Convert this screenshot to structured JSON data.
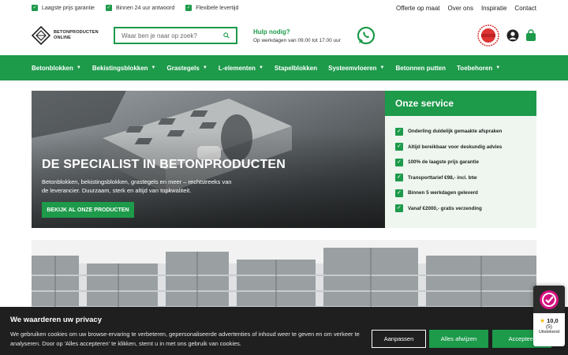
{
  "topbar": {
    "usps": [
      "Laagste prijs garantie",
      "Binnen 24 uur antwoord",
      "Flexibele levertijd"
    ],
    "links": [
      "Offerte op maat",
      "Over ons",
      "Inspiratie",
      "Contact"
    ]
  },
  "header": {
    "logo_line1": "BETONPRODUCTEN",
    "logo_line2": "ONLINE",
    "search_placeholder": "Waar ben je naar op zoek?",
    "help_title": "Hulp nodig?",
    "help_hours": "Op werkdagen van 09.00 tot 17.00 uur"
  },
  "nav": [
    {
      "label": "Betonblokken",
      "dropdown": true
    },
    {
      "label": "Bekistingsblokken",
      "dropdown": true
    },
    {
      "label": "Grastegels",
      "dropdown": true
    },
    {
      "label": "L-elementen",
      "dropdown": true
    },
    {
      "label": "Stapelblokken",
      "dropdown": false
    },
    {
      "label": "Systeemvloeren",
      "dropdown": true
    },
    {
      "label": "Betonnen putten",
      "dropdown": false
    },
    {
      "label": "Toebehoren",
      "dropdown": true
    }
  ],
  "hero": {
    "title": "DE SPECIALIST IN BETONPRODUCTEN",
    "text": "Betonblokken, bekistingsblokken, grastegels en meer – rechtstreeks van de leverancier. Duurzaam, sterk en altijd van topkwaliteit.",
    "button": "BEKIJK AL ONZE PRODUCTEN"
  },
  "service": {
    "title": "Onze service",
    "items": [
      "Onderling duidelijk gemaakte afspraken",
      "Altijd bereikbaar voor deskundig advies",
      "100% de laagste prijs garantie",
      "Transporttarief €98,- incl. btw",
      "Binnen 5 werkdagen geleverd",
      "Vanaf €2000,- gratis verzending"
    ]
  },
  "cookie": {
    "title": "We waarderen uw privacy",
    "text": "We gebruiken cookies om uw browse-ervaring te verbeteren, gepersonaliseerde advertenties of inhoud weer te geven en om verkeer te analyseren. Door op 'Alles accepteren' te klikken, stemt u in met ons gebruik van cookies.",
    "btn_customize": "Aanpassen",
    "btn_reject": "Alles afwijzen",
    "btn_accept": "Accepteer"
  },
  "review": {
    "score": "10,0",
    "count": "(5)",
    "label": "Uitstekend"
  },
  "colors": {
    "brand": "#1d9a4a",
    "dark": "#1f1f1f"
  }
}
